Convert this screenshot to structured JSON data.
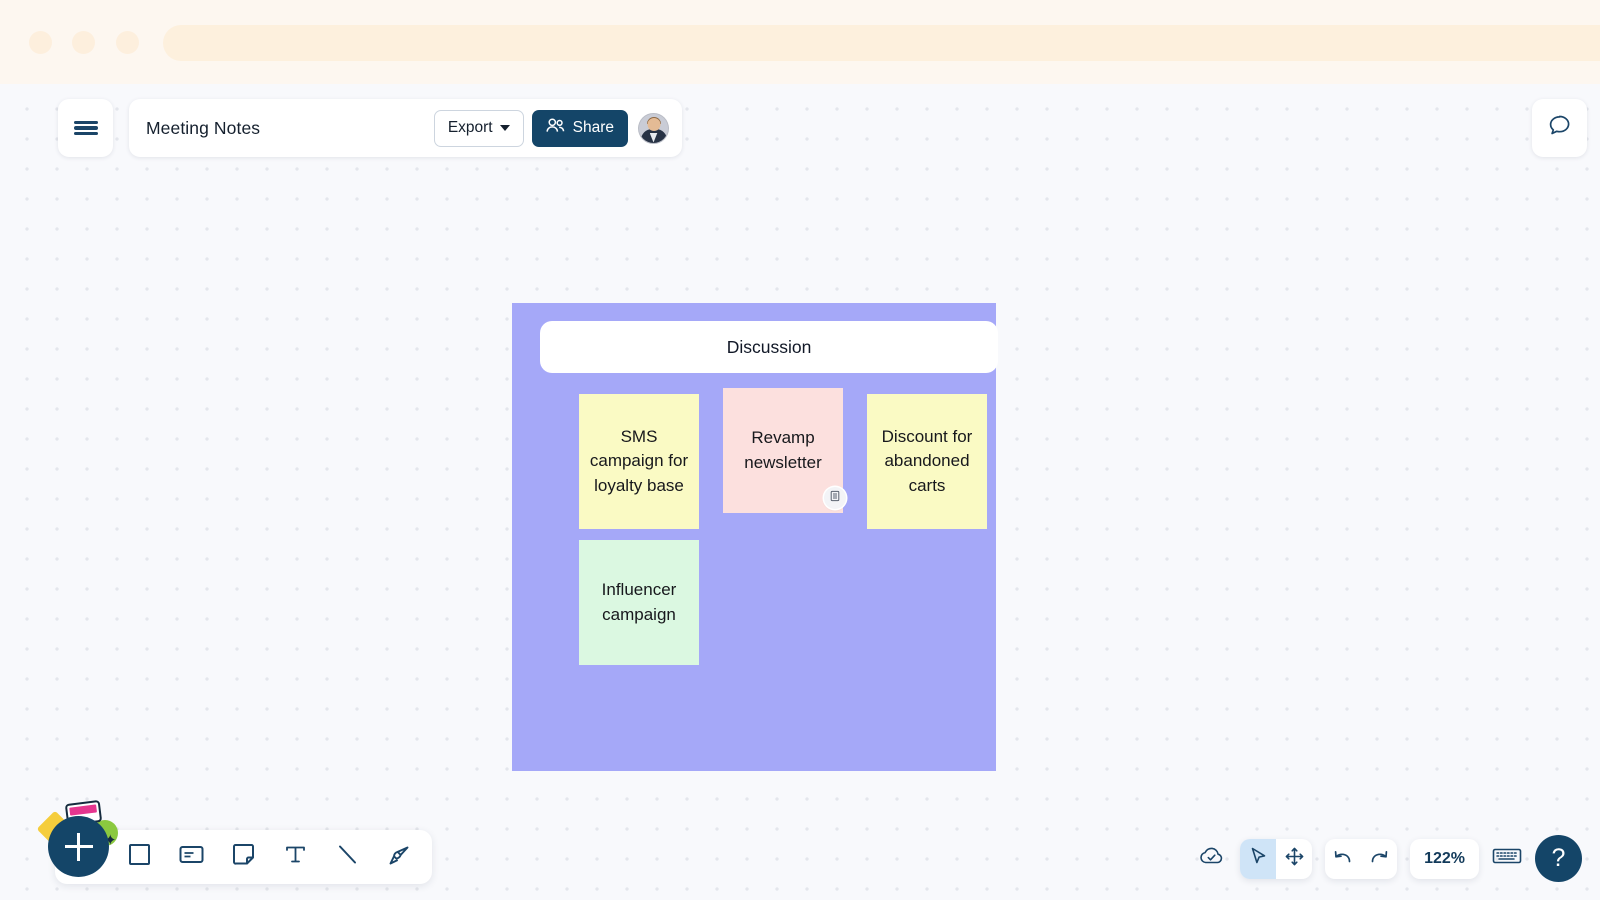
{
  "browser": {
    "traffic_lights": [
      "close",
      "minimize",
      "maximize"
    ],
    "url_value": ""
  },
  "topbar": {
    "menu_icon": "hamburger-menu-icon",
    "doc_title": "Meeting Notes",
    "export_label": "Export",
    "export_caret_icon": "chevron-down-icon",
    "share_label": "Share",
    "share_icon": "people-icon",
    "avatar_alt": "user-avatar",
    "comment_icon": "comment-bubble-icon"
  },
  "board": {
    "frame_title": "Discussion",
    "frame_color": "#a5a8f8",
    "notes": [
      {
        "id": "sms",
        "text": "SMS campaign for loyalty base",
        "color": "#fafac4"
      },
      {
        "id": "newsletter",
        "text": "Revamp newsletter",
        "color": "#fce0de"
      },
      {
        "id": "discount",
        "text": "Discount for abandoned carts",
        "color": "#fafac4"
      },
      {
        "id": "influencer",
        "text": "Influencer campaign",
        "color": "#dbf8e1"
      }
    ],
    "note_badge_icon": "notes-list-icon"
  },
  "create_toolbar": {
    "add_label": "+",
    "tools": [
      {
        "id": "shape",
        "icon": "square-shape-icon",
        "label": "Shape"
      },
      {
        "id": "card",
        "icon": "card-icon",
        "label": "Card"
      },
      {
        "id": "note",
        "icon": "sticky-note-icon",
        "label": "Sticky note"
      },
      {
        "id": "text",
        "icon": "text-tool-icon",
        "label": "Text"
      },
      {
        "id": "line",
        "icon": "line-tool-icon",
        "label": "Line"
      },
      {
        "id": "marker",
        "icon": "marker-pen-icon",
        "label": "Marker"
      }
    ]
  },
  "view_controls": {
    "cloud_icon": "cloud-saved-icon",
    "select_icon": "cursor-arrow-icon",
    "pan_icon": "move-arrows-icon",
    "undo_icon": "undo-arrow-icon",
    "redo_icon": "redo-arrow-icon",
    "zoom_level": "122%",
    "keyboard_icon": "keyboard-icon",
    "help_label": "?"
  },
  "colors": {
    "accent_dark": "#144568",
    "canvas_bg": "#f8f9fc",
    "chrome_bg": "#fdf7f0",
    "selection_blue": "#cfe4f7"
  }
}
